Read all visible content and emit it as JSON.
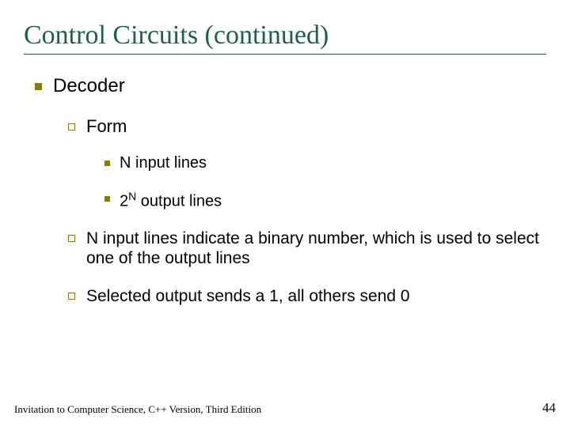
{
  "title": "Control Circuits (continued)",
  "bullets": {
    "lvl1": "Decoder",
    "lvl2_form": "Form",
    "lvl3_a": "N input lines",
    "lvl3_b_pre": "2",
    "lvl3_b_sup": "N",
    "lvl3_b_post": " output lines",
    "lvl2_b": "N input lines indicate a binary number, which is used to select one of the output lines",
    "lvl2_c": "Selected output sends a 1, all others send 0"
  },
  "footer": {
    "left": "Invitation to Computer Science, C++ Version, Third Edition",
    "right": "44"
  }
}
